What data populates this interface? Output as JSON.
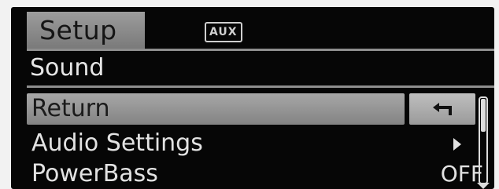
{
  "header": {
    "tab_label": "Setup",
    "source_badge": "AUX"
  },
  "section": {
    "title": "Sound"
  },
  "menu": {
    "items": [
      {
        "label": "Return",
        "icon": "return-arrow-icon",
        "selected": true
      },
      {
        "label": "Audio Settings",
        "icon": "chevron-right-icon",
        "selected": false
      },
      {
        "label": "PowerBass",
        "value": "OFF",
        "selected": false
      }
    ]
  },
  "colors": {
    "screen_bg": "#060606",
    "highlight": "#9a9a9a",
    "text": "#e2e2e2"
  }
}
